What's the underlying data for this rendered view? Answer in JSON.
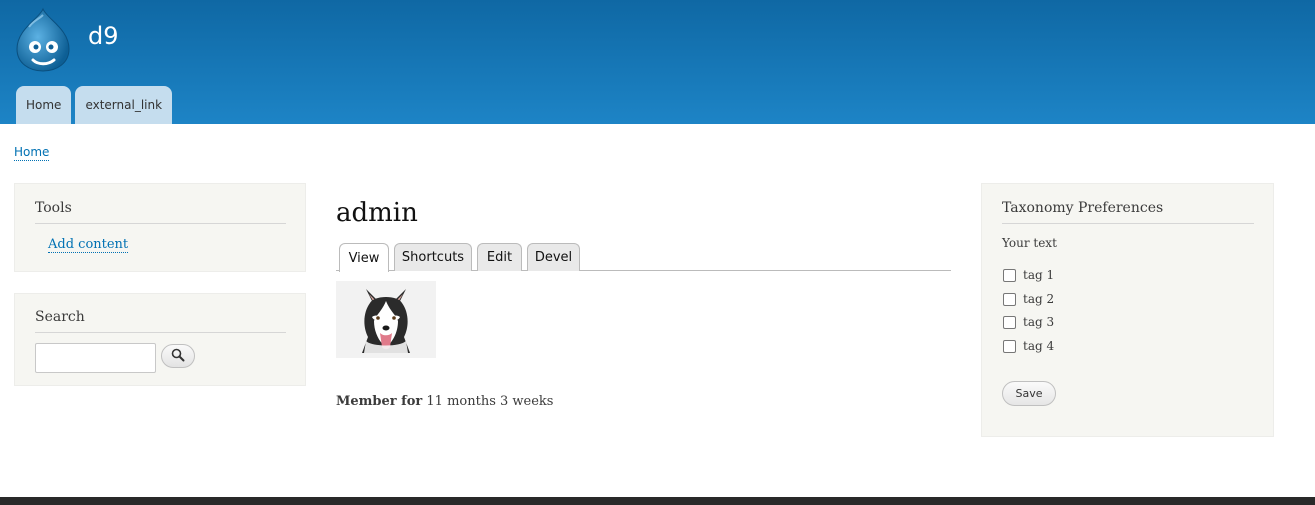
{
  "header": {
    "site_name": "d9",
    "logo_icon": "drupal-drop-icon",
    "menu": [
      {
        "label": "Home"
      },
      {
        "label": "external_link"
      }
    ]
  },
  "breadcrumb": {
    "items": [
      "Home"
    ]
  },
  "sidebar_first": {
    "tools": {
      "title": "Tools",
      "links": [
        "Add content"
      ]
    },
    "search": {
      "title": "Search",
      "input_value": "",
      "button_icon": "search-icon"
    }
  },
  "content": {
    "title": "admin",
    "tabs": [
      {
        "label": "View",
        "active": true
      },
      {
        "label": "Shortcuts",
        "active": false
      },
      {
        "label": "Edit",
        "active": false
      },
      {
        "label": "Devel",
        "active": false
      }
    ],
    "avatar": "husky-dog-photo",
    "member_label": "Member for",
    "member_value": "11 months 3 weeks"
  },
  "sidebar_second": {
    "taxonomy": {
      "title": "Taxonomy Preferences",
      "subtitle": "Your text",
      "options": [
        {
          "label": "tag 1",
          "checked": false
        },
        {
          "label": "tag 2",
          "checked": false
        },
        {
          "label": "tag 3",
          "checked": false
        },
        {
          "label": "tag 4",
          "checked": false
        }
      ],
      "save_label": "Save"
    }
  },
  "colors": {
    "header_top": "#0f68a4",
    "header_bottom": "#1d84c6",
    "link": "#0071b3",
    "block_bg": "#f6f6f2",
    "menu_tab_bg": "#c5ddee"
  }
}
